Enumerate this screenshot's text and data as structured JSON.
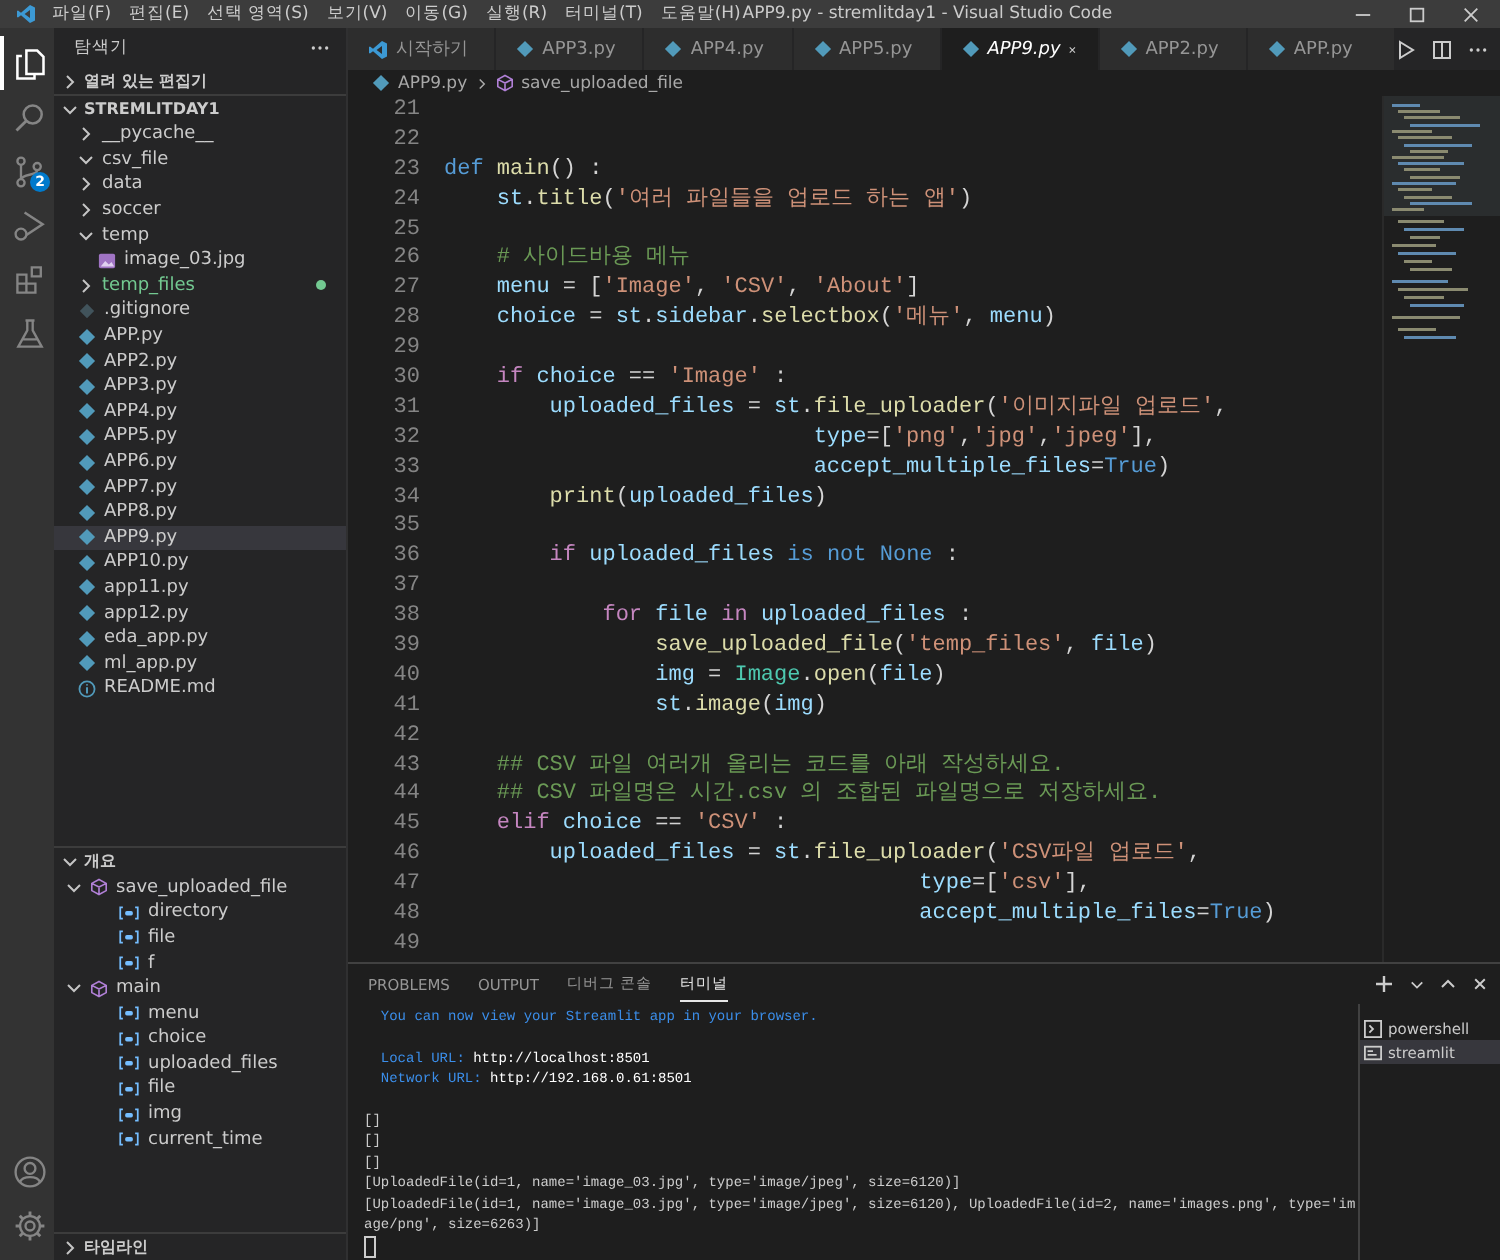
{
  "title_bar": {
    "menus": [
      "파일(F)",
      "편집(E)",
      "선택 영역(S)",
      "보기(V)",
      "이동(G)",
      "실행(R)",
      "터미널(T)",
      "도움말(H)"
    ],
    "title": "APP9.py - stremlitday1 - Visual Studio Code"
  },
  "activity_bar": {
    "items": [
      {
        "kind": "explorer",
        "selected": true
      },
      {
        "kind": "search",
        "selected": false
      },
      {
        "kind": "source_control",
        "selected": false,
        "badge": "2"
      },
      {
        "kind": "run",
        "selected": false
      },
      {
        "kind": "extensions",
        "selected": false
      },
      {
        "kind": "testing",
        "selected": false
      }
    ],
    "bottom": [
      {
        "kind": "account"
      },
      {
        "kind": "settings"
      }
    ]
  },
  "sidebar": {
    "title": "탐색기",
    "open_editors": {
      "label": "열려 있는 편집기",
      "expanded": false
    },
    "project": {
      "label": "STREMLITDAY1",
      "expanded": true
    },
    "tree": [
      {
        "label": "__pycache__",
        "kind": "folder",
        "expanded": false,
        "selected": false,
        "untracked": false
      },
      {
        "label": "csv_file",
        "kind": "folder",
        "expanded": true,
        "selected": false,
        "untracked": false
      },
      {
        "label": "data",
        "kind": "folder",
        "expanded": false,
        "selected": false,
        "untracked": false
      },
      {
        "label": "soccer",
        "kind": "folder",
        "expanded": false,
        "selected": false,
        "untracked": false
      },
      {
        "label": "temp",
        "kind": "folder",
        "expanded": true,
        "selected": false,
        "untracked": false,
        "children": [
          {
            "label": "image_03.jpg",
            "kind": "image",
            "selected": false,
            "untracked": false
          }
        ]
      },
      {
        "label": "temp_files",
        "kind": "folder",
        "expanded": false,
        "selected": false,
        "untracked": true
      },
      {
        "label": ".gitignore",
        "kind": "git",
        "selected": false,
        "untracked": false
      },
      {
        "label": "APP.py",
        "kind": "python",
        "selected": false,
        "untracked": false
      },
      {
        "label": "APP2.py",
        "kind": "python",
        "selected": false,
        "untracked": false
      },
      {
        "label": "APP3.py",
        "kind": "python",
        "selected": false,
        "untracked": false
      },
      {
        "label": "APP4.py",
        "kind": "python",
        "selected": false,
        "untracked": false
      },
      {
        "label": "APP5.py",
        "kind": "python",
        "selected": false,
        "untracked": false
      },
      {
        "label": "APP6.py",
        "kind": "python",
        "selected": false,
        "untracked": false
      },
      {
        "label": "APP7.py",
        "kind": "python",
        "selected": false,
        "untracked": false
      },
      {
        "label": "APP8.py",
        "kind": "python",
        "selected": false,
        "untracked": false
      },
      {
        "label": "APP9.py",
        "kind": "python",
        "selected": true,
        "untracked": false
      },
      {
        "label": "APP10.py",
        "kind": "python",
        "selected": false,
        "untracked": false
      },
      {
        "label": "app11.py",
        "kind": "python",
        "selected": false,
        "untracked": false
      },
      {
        "label": "app12.py",
        "kind": "python",
        "selected": false,
        "untracked": false
      },
      {
        "label": "eda_app.py",
        "kind": "python",
        "selected": false,
        "untracked": false
      },
      {
        "label": "ml_app.py",
        "kind": "python",
        "selected": false,
        "untracked": false
      },
      {
        "label": "README.md",
        "kind": "info",
        "selected": false,
        "untracked": false
      }
    ],
    "outline": {
      "label": "개요",
      "expanded": true,
      "items": [
        {
          "label": "save_uploaded_file",
          "kind": "function",
          "expanded": true,
          "children": [
            {
              "label": "directory",
              "kind": "variable"
            },
            {
              "label": "file",
              "kind": "variable"
            },
            {
              "label": "f",
              "kind": "variable"
            }
          ]
        },
        {
          "label": "main",
          "kind": "function",
          "expanded": true,
          "children": [
            {
              "label": "menu",
              "kind": "variable"
            },
            {
              "label": "choice",
              "kind": "variable"
            },
            {
              "label": "uploaded_files",
              "kind": "variable"
            },
            {
              "label": "file",
              "kind": "variable"
            },
            {
              "label": "img",
              "kind": "variable"
            },
            {
              "label": "current_time",
              "kind": "variable"
            }
          ]
        }
      ]
    },
    "timeline": {
      "label": "타임라인",
      "expanded": false
    }
  },
  "tabs": [
    {
      "label": "시작하기",
      "kind": "welcome",
      "selected": false
    },
    {
      "label": "APP3.py",
      "kind": "python",
      "selected": false
    },
    {
      "label": "APP4.py",
      "kind": "python",
      "selected": false
    },
    {
      "label": "APP5.py",
      "kind": "python",
      "selected": false
    },
    {
      "label": "APP9.py",
      "kind": "python",
      "selected": true
    },
    {
      "label": "APP2.py",
      "kind": "python",
      "selected": false
    },
    {
      "label": "APP.py",
      "kind": "python",
      "selected": false
    }
  ],
  "breadcrumb": [
    {
      "label": "APP9.py",
      "kind": "python"
    },
    {
      "label": "save_uploaded_file",
      "kind": "function"
    }
  ],
  "code": [
    {
      "num": "21"
    },
    {
      "num": "22"
    },
    {
      "num": "23",
      "tokens": [
        {
          "kind": "kw",
          "text": "def "
        },
        {
          "kind": "fn",
          "text": "main"
        },
        {
          "kind": "plain",
          "text": "() :"
        }
      ]
    },
    {
      "num": "24",
      "tokens": [
        {
          "kind": "var",
          "text": "    st"
        },
        {
          "kind": "plain",
          "text": "."
        },
        {
          "kind": "fn",
          "text": "title"
        },
        {
          "kind": "plain",
          "text": "("
        },
        {
          "kind": "str",
          "text": "'여러 파일들을 업로드 하는 앱'"
        },
        {
          "kind": "plain",
          "text": ")"
        }
      ]
    },
    {
      "num": "25"
    },
    {
      "num": "26",
      "tokens": [
        {
          "kind": "cm",
          "text": "    # 사이드바용 메뉴"
        }
      ]
    },
    {
      "num": "27",
      "tokens": [
        {
          "kind": "var",
          "text": "    menu"
        },
        {
          "kind": "plain",
          "text": " = ["
        },
        {
          "kind": "str",
          "text": "'Image'"
        },
        {
          "kind": "plain",
          "text": ", "
        },
        {
          "kind": "str",
          "text": "'CSV'"
        },
        {
          "kind": "plain",
          "text": ", "
        },
        {
          "kind": "str",
          "text": "'About'"
        },
        {
          "kind": "plain",
          "text": "]"
        }
      ]
    },
    {
      "num": "28",
      "tokens": [
        {
          "kind": "var",
          "text": "    choice"
        },
        {
          "kind": "plain",
          "text": " = "
        },
        {
          "kind": "var",
          "text": "st"
        },
        {
          "kind": "plain",
          "text": "."
        },
        {
          "kind": "var",
          "text": "sidebar"
        },
        {
          "kind": "plain",
          "text": "."
        },
        {
          "kind": "fn",
          "text": "selectbox"
        },
        {
          "kind": "plain",
          "text": "("
        },
        {
          "kind": "str",
          "text": "'메뉴'"
        },
        {
          "kind": "plain",
          "text": ", "
        },
        {
          "kind": "var",
          "text": "menu"
        },
        {
          "kind": "plain",
          "text": ")"
        }
      ]
    },
    {
      "num": "29"
    },
    {
      "num": "30",
      "tokens": [
        {
          "kind": "ctl",
          "text": "    if "
        },
        {
          "kind": "var",
          "text": "choice"
        },
        {
          "kind": "plain",
          "text": " == "
        },
        {
          "kind": "str",
          "text": "'Image'"
        },
        {
          "kind": "plain",
          "text": " :"
        }
      ]
    },
    {
      "num": "31",
      "tokens": [
        {
          "kind": "var",
          "text": "        uploaded_files"
        },
        {
          "kind": "plain",
          "text": " = "
        },
        {
          "kind": "var",
          "text": "st"
        },
        {
          "kind": "plain",
          "text": "."
        },
        {
          "kind": "fn",
          "text": "file_uploader"
        },
        {
          "kind": "plain",
          "text": "("
        },
        {
          "kind": "str",
          "text": "'이미지파일 업로드'"
        },
        {
          "kind": "plain",
          "text": ","
        }
      ]
    },
    {
      "num": "32",
      "tokens": [
        {
          "kind": "var",
          "text": "                            type"
        },
        {
          "kind": "plain",
          "text": "=["
        },
        {
          "kind": "str",
          "text": "'png'"
        },
        {
          "kind": "plain",
          "text": ","
        },
        {
          "kind": "str",
          "text": "'jpg'"
        },
        {
          "kind": "plain",
          "text": ","
        },
        {
          "kind": "str",
          "text": "'jpeg'"
        },
        {
          "kind": "plain",
          "text": "],"
        }
      ]
    },
    {
      "num": "33",
      "tokens": [
        {
          "kind": "var",
          "text": "                            accept_multiple_files"
        },
        {
          "kind": "plain",
          "text": "="
        },
        {
          "kind": "kw",
          "text": "True"
        },
        {
          "kind": "plain",
          "text": ")"
        }
      ]
    },
    {
      "num": "34",
      "tokens": [
        {
          "kind": "fn",
          "text": "        print"
        },
        {
          "kind": "plain",
          "text": "("
        },
        {
          "kind": "var",
          "text": "uploaded_files"
        },
        {
          "kind": "plain",
          "text": ")"
        }
      ]
    },
    {
      "num": "35"
    },
    {
      "num": "36",
      "tokens": [
        {
          "kind": "ctl",
          "text": "        if "
        },
        {
          "kind": "var",
          "text": "uploaded_files "
        },
        {
          "kind": "kw",
          "text": "is not None"
        },
        {
          "kind": "plain",
          "text": " :"
        }
      ]
    },
    {
      "num": "37"
    },
    {
      "num": "38",
      "tokens": [
        {
          "kind": "ctl",
          "text": "            for "
        },
        {
          "kind": "var",
          "text": "file "
        },
        {
          "kind": "ctl",
          "text": "in "
        },
        {
          "kind": "var",
          "text": "uploaded_files"
        },
        {
          "kind": "plain",
          "text": " :"
        }
      ]
    },
    {
      "num": "39",
      "tokens": [
        {
          "kind": "fn",
          "text": "                save_uploaded_file"
        },
        {
          "kind": "plain",
          "text": "("
        },
        {
          "kind": "str",
          "text": "'temp_files'"
        },
        {
          "kind": "plain",
          "text": ", "
        },
        {
          "kind": "var",
          "text": "file"
        },
        {
          "kind": "plain",
          "text": ")"
        }
      ]
    },
    {
      "num": "40",
      "tokens": [
        {
          "kind": "var",
          "text": "                img"
        },
        {
          "kind": "plain",
          "text": " = "
        },
        {
          "kind": "cls",
          "text": "Image"
        },
        {
          "kind": "plain",
          "text": "."
        },
        {
          "kind": "fn",
          "text": "open"
        },
        {
          "kind": "plain",
          "text": "("
        },
        {
          "kind": "var",
          "text": "file"
        },
        {
          "kind": "plain",
          "text": ")"
        }
      ]
    },
    {
      "num": "41",
      "tokens": [
        {
          "kind": "var",
          "text": "                st"
        },
        {
          "kind": "plain",
          "text": "."
        },
        {
          "kind": "fn",
          "text": "image"
        },
        {
          "kind": "plain",
          "text": "("
        },
        {
          "kind": "var",
          "text": "img"
        },
        {
          "kind": "plain",
          "text": ")"
        }
      ]
    },
    {
      "num": "42"
    },
    {
      "num": "43",
      "tokens": [
        {
          "kind": "cm",
          "text": "    ## CSV 파일 여러개 올리는 코드를 아래 작성하세요."
        }
      ]
    },
    {
      "num": "44",
      "tokens": [
        {
          "kind": "cm",
          "text": "    ## CSV 파일명은 시간.csv 의 조합된 파일명으로 저장하세요."
        }
      ]
    },
    {
      "num": "45",
      "tokens": [
        {
          "kind": "ctl",
          "text": "    elif "
        },
        {
          "kind": "var",
          "text": "choice"
        },
        {
          "kind": "plain",
          "text": " == "
        },
        {
          "kind": "str",
          "text": "'CSV'"
        },
        {
          "kind": "plain",
          "text": " :"
        }
      ]
    },
    {
      "num": "46",
      "tokens": [
        {
          "kind": "var",
          "text": "        uploaded_files"
        },
        {
          "kind": "plain",
          "text": " = "
        },
        {
          "kind": "var",
          "text": "st"
        },
        {
          "kind": "plain",
          "text": "."
        },
        {
          "kind": "fn",
          "text": "file_uploader"
        },
        {
          "kind": "plain",
          "text": "("
        },
        {
          "kind": "str",
          "text": "'CSV파일 업로드'"
        },
        {
          "kind": "plain",
          "text": ","
        }
      ]
    },
    {
      "num": "47",
      "tokens": [
        {
          "kind": "var",
          "text": "                                    type"
        },
        {
          "kind": "plain",
          "text": "=["
        },
        {
          "kind": "str",
          "text": "'csv'"
        },
        {
          "kind": "plain",
          "text": "],"
        }
      ]
    },
    {
      "num": "48",
      "tokens": [
        {
          "kind": "var",
          "text": "                                    accept_multiple_files"
        },
        {
          "kind": "plain",
          "text": "="
        },
        {
          "kind": "kw",
          "text": "True"
        },
        {
          "kind": "plain",
          "text": ")"
        }
      ]
    },
    {
      "num": "49"
    }
  ],
  "panel": {
    "tabs": [
      {
        "label": "PROBLEMS",
        "selected": false
      },
      {
        "label": "OUTPUT",
        "selected": false
      },
      {
        "label": "디버그 콘솔",
        "selected": false
      },
      {
        "label": "터미널",
        "selected": true
      }
    ],
    "terminal": [
      {
        "lines": [
          {
            "segments": [
              {
                "kind": "info",
                "text": "  You can now view your Streamlit app in your browser."
              }
            ]
          }
        ]
      },
      {
        "lines": [
          {
            "segments": [
              {
                "kind": "info",
                "text": "  Local URL: "
              },
              {
                "kind": "url",
                "text": "http://localhost:8501"
              }
            ]
          },
          {
            "segments": [
              {
                "kind": "info",
                "text": "  Network URL: "
              },
              {
                "kind": "url",
                "text": "http://192.168.0.61:8501"
              }
            ]
          }
        ]
      },
      {
        "lines": [
          {
            "segments": [
              {
                "kind": "out",
                "text": "[]"
              }
            ]
          },
          {
            "segments": [
              {
                "kind": "out",
                "text": "[]"
              }
            ]
          },
          {
            "segments": [
              {
                "kind": "out",
                "text": "[]"
              }
            ]
          },
          {
            "segments": [
              {
                "kind": "out",
                "text": "[UploadedFile(id=1, name='image_03.jpg', type='image/jpeg', size=6120)]"
              }
            ]
          },
          {
            "segments": [
              {
                "kind": "out",
                "text": "[UploadedFile(id=1, name='image_03.jpg', type='image/jpeg', size=6120), UploadedFile(id=2, name='images.png', type='im"
              }
            ]
          },
          {
            "segments": [
              {
                "kind": "out",
                "text": "age/png', size=6263)]"
              }
            ]
          }
        ]
      }
    ],
    "sessions": [
      {
        "label": "powershell",
        "kind": "shell",
        "selected": false
      },
      {
        "label": "streamlit",
        "kind": "task",
        "selected": true
      }
    ]
  }
}
